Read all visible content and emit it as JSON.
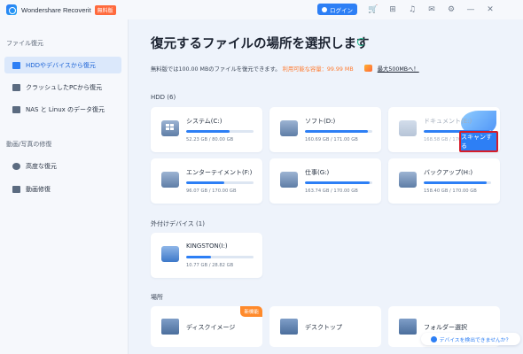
{
  "app": {
    "title": "Wondershare Recoverit",
    "badge": "無料版"
  },
  "topbar": {
    "login_label": "ログイン"
  },
  "sidebar": {
    "section1": "ファイル復元",
    "items1": [
      {
        "label": "HDDやデバイスから復元",
        "active": true
      },
      {
        "label": "クラッシュしたPCから復元"
      },
      {
        "label": "NAS と Linux のデータ復元"
      }
    ],
    "section2": "動画/写真の修復",
    "items2": [
      {
        "label": "高度な復元"
      },
      {
        "label": "動画修復"
      }
    ]
  },
  "main": {
    "title": "復元するファイルの場所を選択します",
    "quota_text": "無料版では100.00 MBのファイルを復元できます。",
    "quota_cap": "利用可能な容量：99.99 MB",
    "upgrade": "最大500MBへ！",
    "hdd_label": "HDD (6)",
    "external_label": "外付けデバイス (1)",
    "places_label": "場所",
    "scan_button": "スキャンする",
    "detect_link": "デバイスを検出できませんか？"
  },
  "drives": [
    {
      "name": "システム(C:)",
      "size": "52.23 GB / 80.00 GB",
      "used": 0.65
    },
    {
      "name": "ソフト(D:)",
      "size": "160.69 GB / 171.00 GB",
      "used": 0.94
    },
    {
      "name": "ドキュメント(E:)",
      "size": "168.58 GB / 170.00 GB",
      "used": 0.99
    },
    {
      "name": "エンターテイメント(F:)",
      "size": "96.07 GB / 170.00 GB",
      "used": 0.57
    },
    {
      "name": "仕事(G:)",
      "size": "163.74 GB / 170.00 GB",
      "used": 0.96
    },
    {
      "name": "バックアップ(H:)",
      "size": "158.40 GB / 170.00 GB",
      "used": 0.93
    }
  ],
  "external": [
    {
      "name": "KINGSTON(I:)",
      "size": "10.77 GB / 28.82 GB",
      "used": 0.37
    }
  ],
  "places": [
    {
      "label": "ディスクイメージ",
      "badge": "新機能"
    },
    {
      "label": "デスクトップ"
    },
    {
      "label": "フォルダー選択"
    }
  ]
}
